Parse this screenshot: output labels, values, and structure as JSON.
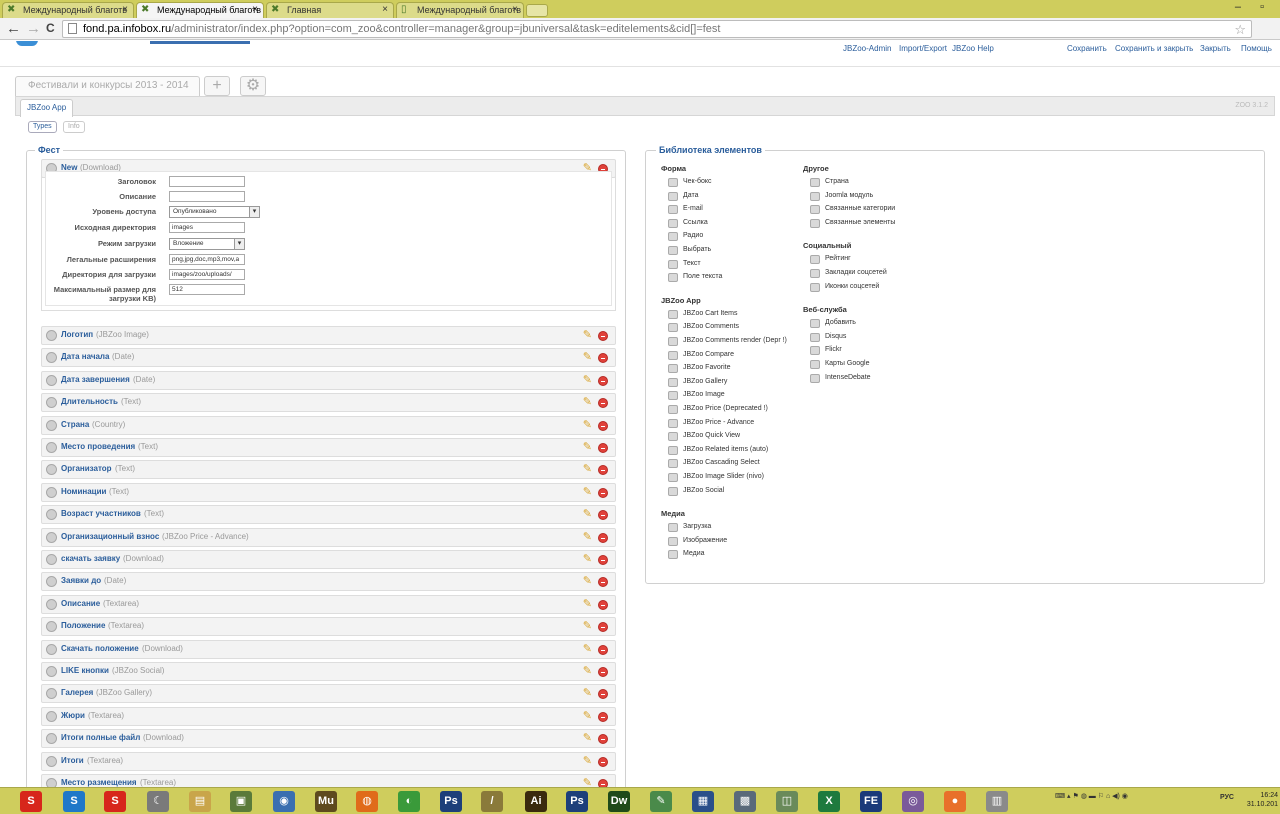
{
  "browser": {
    "tabs": [
      {
        "label": "Международный благотв"
      },
      {
        "label": "Международный благотв"
      },
      {
        "label": "Главная"
      },
      {
        "label": "Международный благотв"
      }
    ],
    "close": "×",
    "window_controls": "– ▫",
    "nav_back": "←",
    "nav_forward": "→",
    "nav_reload": "C",
    "url_domain": "fond.pa.infobox.ru",
    "url_path": "/administrator/index.php?option=com_zoo&controller=manager&group=jbuniversal&task=editelements&cid[]=fest",
    "star": "☆"
  },
  "admin": {
    "links_left": [
      "JBZoo-Admin",
      "Import/Export",
      "JBZoo Help"
    ],
    "links_right": [
      "Сохранить",
      "Сохранить и закрыть",
      "Закрыть",
      "Помощь"
    ]
  },
  "app": {
    "tab_label": "Фестивали и конкурсы 2013 - 2014",
    "add_glyph": "+",
    "settings_glyph": "⚙",
    "subtab_label": "JBZoo App",
    "version": "ZOO 3.1.2",
    "pill_types": "Types",
    "pill_info": "Info"
  },
  "fest": {
    "legend": "Фест",
    "new_element": {
      "name": "New",
      "type": "(Download)"
    },
    "props": [
      {
        "label": "Заголовок",
        "value": ""
      },
      {
        "label": "Описание",
        "value": ""
      },
      {
        "label": "Уровень доступа",
        "value": "Опубликовано"
      },
      {
        "label": "Исходная директория",
        "value": "images"
      },
      {
        "label": "Режим загрузки",
        "value": "Вложение"
      },
      {
        "label": "Легальные расширения",
        "value": "png,jpg,doc,mp3,mov,a"
      },
      {
        "label": "Директория для загрузки",
        "value": "images/zoo/uploads/"
      },
      {
        "label": "Максимальный размер для загрузки KB)",
        "value": "512"
      }
    ],
    "elements": [
      {
        "name": "Логотип",
        "type": "(JBZoo Image)"
      },
      {
        "name": "Дата начала",
        "type": "(Date)"
      },
      {
        "name": "Дата завершения",
        "type": "(Date)"
      },
      {
        "name": "Длительность",
        "type": "(Text)"
      },
      {
        "name": "Страна",
        "type": "(Country)"
      },
      {
        "name": "Место проведения",
        "type": "(Text)"
      },
      {
        "name": "Организатор",
        "type": "(Text)"
      },
      {
        "name": "Номинации",
        "type": "(Text)"
      },
      {
        "name": "Возраст участников",
        "type": "(Text)"
      },
      {
        "name": "Организационный взнос",
        "type": "(JBZoo Price - Advance)"
      },
      {
        "name": "скачать заявку",
        "type": "(Download)"
      },
      {
        "name": "Заявки до",
        "type": "(Date)"
      },
      {
        "name": "Описание",
        "type": "(Textarea)"
      },
      {
        "name": "Положение",
        "type": "(Textarea)"
      },
      {
        "name": "Скачать положение",
        "type": "(Download)"
      },
      {
        "name": "LIKE кнопки",
        "type": "(JBZoo Social)"
      },
      {
        "name": "Галерея",
        "type": "(JBZoo Gallery)"
      },
      {
        "name": "Жюри",
        "type": "(Textarea)"
      },
      {
        "name": "Итоги полные файл",
        "type": "(Download)"
      },
      {
        "name": "Итоги",
        "type": "(Textarea)"
      },
      {
        "name": "Место размещения",
        "type": "(Textarea)"
      }
    ]
  },
  "library": {
    "legend": "Библиотека элементов",
    "groups_left": [
      {
        "title": "Форма",
        "items": [
          "Чек-бокс",
          "Дата",
          "E-mail",
          "Ссылка",
          "Радио",
          "Выбрать",
          "Текст",
          "Поле текста"
        ]
      },
      {
        "title": "JBZoo App",
        "items": [
          "JBZoo Cart Items",
          "JBZoo Comments",
          "JBZoo Comments render (Depr !)",
          "JBZoo Compare",
          "JBZoo Favorite",
          "JBZoo Gallery",
          "JBZoo Image",
          "JBZoo Price (Deprecated !)",
          "JBZoo Price - Advance",
          "JBZoo Quick View",
          "JBZoo Related items (auto)",
          "JBZoo Cascading Select",
          "JBZoo Image Slider (nivo)",
          "JBZoo Social"
        ]
      },
      {
        "title": "Медиа",
        "items": [
          "Загрузка",
          "Изображение",
          "Медиа"
        ]
      }
    ],
    "groups_right": [
      {
        "title": "Другое",
        "items": [
          "Страна",
          "Joomla модуль",
          "Связанные категории",
          "Связанные элементы"
        ]
      },
      {
        "title": "Социальный",
        "items": [
          "Рейтинг",
          "Закладки соцсетей",
          "Иконки соцсетей"
        ]
      },
      {
        "title": "Веб-служба",
        "items": [
          "Добавить",
          "Disqus",
          "Flickr",
          "Карты Google",
          "IntenseDebate"
        ]
      }
    ]
  },
  "taskbar": {
    "apps": [
      {
        "glyph": "S",
        "color": "#d7261b"
      },
      {
        "glyph": "S",
        "color": "#1f78c8"
      },
      {
        "glyph": "S",
        "color": "#d7261b"
      },
      {
        "glyph": "☾",
        "color": "#7a7a7a"
      },
      {
        "glyph": "▤",
        "color": "#c9a54a"
      },
      {
        "glyph": "▣",
        "color": "#5a7a3a"
      },
      {
        "glyph": "◉",
        "color": "#3a6fb0"
      },
      {
        "glyph": "Mu",
        "color": "#5e4a1e"
      },
      {
        "glyph": "◍",
        "color": "#e06b1a"
      },
      {
        "glyph": "◐",
        "color": "#3a9a3a"
      },
      {
        "glyph": "Ps",
        "color": "#1d3f7a"
      },
      {
        "glyph": "/",
        "color": "#8a7a3a"
      },
      {
        "glyph": "Ai",
        "color": "#3a2a0e"
      },
      {
        "glyph": "Ps",
        "color": "#1d3f7a"
      },
      {
        "glyph": "Dw",
        "color": "#1f4a1a"
      },
      {
        "glyph": "✎",
        "color": "#4a8a4a"
      },
      {
        "glyph": "▦",
        "color": "#2a4f8a"
      },
      {
        "glyph": "▩",
        "color": "#5a6a7a"
      },
      {
        "glyph": "◫",
        "color": "#6a8a5a"
      },
      {
        "glyph": "X",
        "color": "#1e7a3e"
      },
      {
        "glyph": "FE",
        "color": "#1a3a7a"
      },
      {
        "glyph": "◎",
        "color": "#7a5a9a"
      },
      {
        "glyph": "●",
        "color": "#e8702a"
      },
      {
        "glyph": "▥",
        "color": "#8a8a8a"
      }
    ],
    "tray": "⌨  ▴ ⚑ ◍ ▬ ⚐ ⌂ ◀) ◉",
    "lang": "РУС",
    "time": "16:24",
    "date": "31.10.201"
  }
}
